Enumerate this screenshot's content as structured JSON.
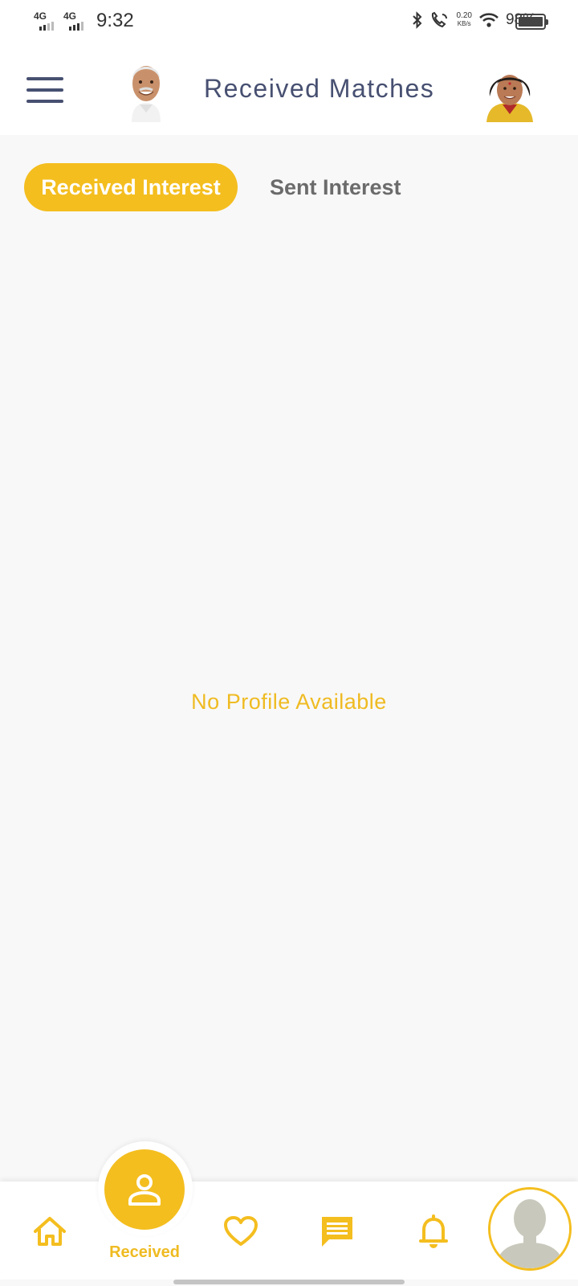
{
  "status_bar": {
    "network_1": "4G",
    "network_2": "4G",
    "time": "9:32",
    "speed_value": "0.20",
    "speed_unit": "KB/s",
    "battery": "98%",
    "icons": [
      "bluetooth-icon",
      "call-icon",
      "wifi-icon",
      "battery-icon"
    ]
  },
  "header": {
    "title": "Received Matches",
    "menu_icon": "hamburger-menu-icon"
  },
  "tabs": [
    {
      "label": "Received Interest",
      "active": true
    },
    {
      "label": "Sent Interest",
      "active": false
    }
  ],
  "main": {
    "empty_message": "No Profile Available"
  },
  "bottom_nav": {
    "items": [
      {
        "icon": "home-icon"
      },
      {
        "icon": "person-icon",
        "label": "Received",
        "active": true
      },
      {
        "icon": "heart-icon"
      },
      {
        "icon": "chat-icon"
      },
      {
        "icon": "bell-icon"
      },
      {
        "icon": "profile-avatar-icon"
      }
    ]
  },
  "colors": {
    "accent": "#f4be1f",
    "title": "#475071",
    "inactive_tab": "#6b6b6b",
    "background": "#f8f8f8"
  }
}
